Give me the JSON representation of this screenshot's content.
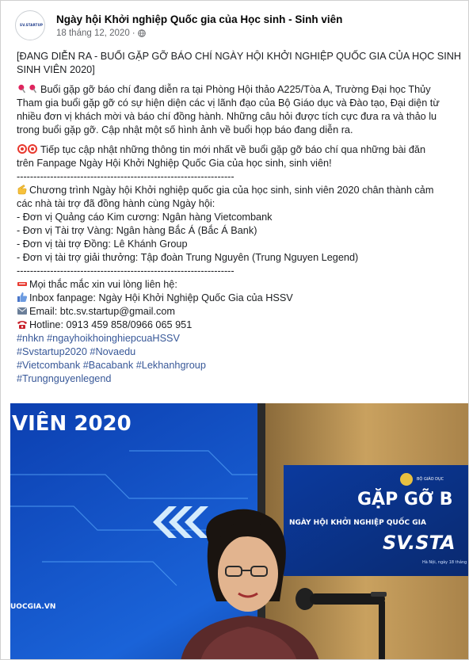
{
  "post": {
    "page_name": "Ngày hội Khởi nghiệp Quốc gia của Học sinh - Sinh viên",
    "date": "18 tháng 12, 2020",
    "separator": "·",
    "avatar_logo_text": "SV.STARTUP",
    "lines": {
      "l1": "[ĐANG DIỄN RA - BUỔI GẶP GỠ BÁO CHÍ NGÀY HỘI KHỞI NGHIỆP QUỐC GIA CỦA HỌC SINH",
      "l2": "SINH VIÊN 2020]",
      "l3": "Buổi gặp gỡ báo chí đang diễn ra tại Phòng Hội thảo A225/Tòa A, Trường Đại học Thủy",
      "l4": "Tham gia buổi gặp gỡ có sự hiện diện các vị lãnh đạo của Bộ Giáo dục và Đào tạo, Đại diện từ",
      "l5": "nhiều đơn vị khách mời và báo chí đồng hành. Những câu hỏi được tích cực đưa ra và thảo lu",
      "l6": "trong buổi gặp gỡ. Cập nhật một số hình ảnh về buổi họp báo đang diễn ra.",
      "l7": "Tiếp tục cập nhật những thông tin mới nhất về buổi gặp gỡ báo chí qua những bài đăn",
      "l8": "trên Fanpage Ngày Hội Khởi Nghiệp Quốc Gia của học sinh, sinh viên!",
      "sep1": "-----------------------------------------------------------------",
      "l9": "Chương trình Ngày hội Khởi nghiệp quốc gia của học sinh, sinh viên 2020 chân thành cảm",
      "l10": "các nhà tài trợ đã đồng hành cùng Ngày hội:",
      "l11": "- Đơn vị Quảng cáo Kim cương: Ngân hàng Vietcombank",
      "l12": "- Đơn vị Tài trợ Vàng: Ngân hàng Bắc Á (Bắc Á Bank)",
      "l13": "- Đơn vị tài trợ Đồng: Lê Khánh Group",
      "l14": "- Đơn vị tài trợ giải thưởng: Tập đoàn Trung Nguyên (Trung Nguyen Legend)",
      "sep2": "-----------------------------------------------------------------",
      "l15": "Mọi thắc mắc xin vui lòng liên hệ:",
      "l16": "Inbox fanpage: Ngày Hội Khởi Nghiệp Quốc Gia của HSSV",
      "l17": "Email: btc.sv.startup@gmail.com",
      "l18": "Hotline: 0913 459 858/0966 065 951"
    },
    "hashtags": {
      "h1": "#nhkn #ngayhoikhoinghiepcuaHSSV",
      "h2": "#Svstartup2020 #Novaedu",
      "h3": "#Vietcombank #Bacabank #Lekhanhgroup",
      "h4": "#Trungnguyenlegend"
    }
  },
  "photo": {
    "banner_left_text": "VIÊN 2020",
    "banner_bottom_text": "UOCGIA.VN",
    "banner_right_title": "GẶP GỠ B",
    "banner_right_subtitle": "NGÀY HỘI KHỞI NGHIỆP QUỐC GIA",
    "banner_right_brand": "SV.STA",
    "banner_right_small": "BỘ GIÁO DỤC",
    "banner_right_date": "Hà Nội, ngày 18 tháng"
  },
  "colors": {
    "hashtag": "#385898",
    "banner_blue": "#0b3a9e",
    "wood": "#c9a15f"
  }
}
